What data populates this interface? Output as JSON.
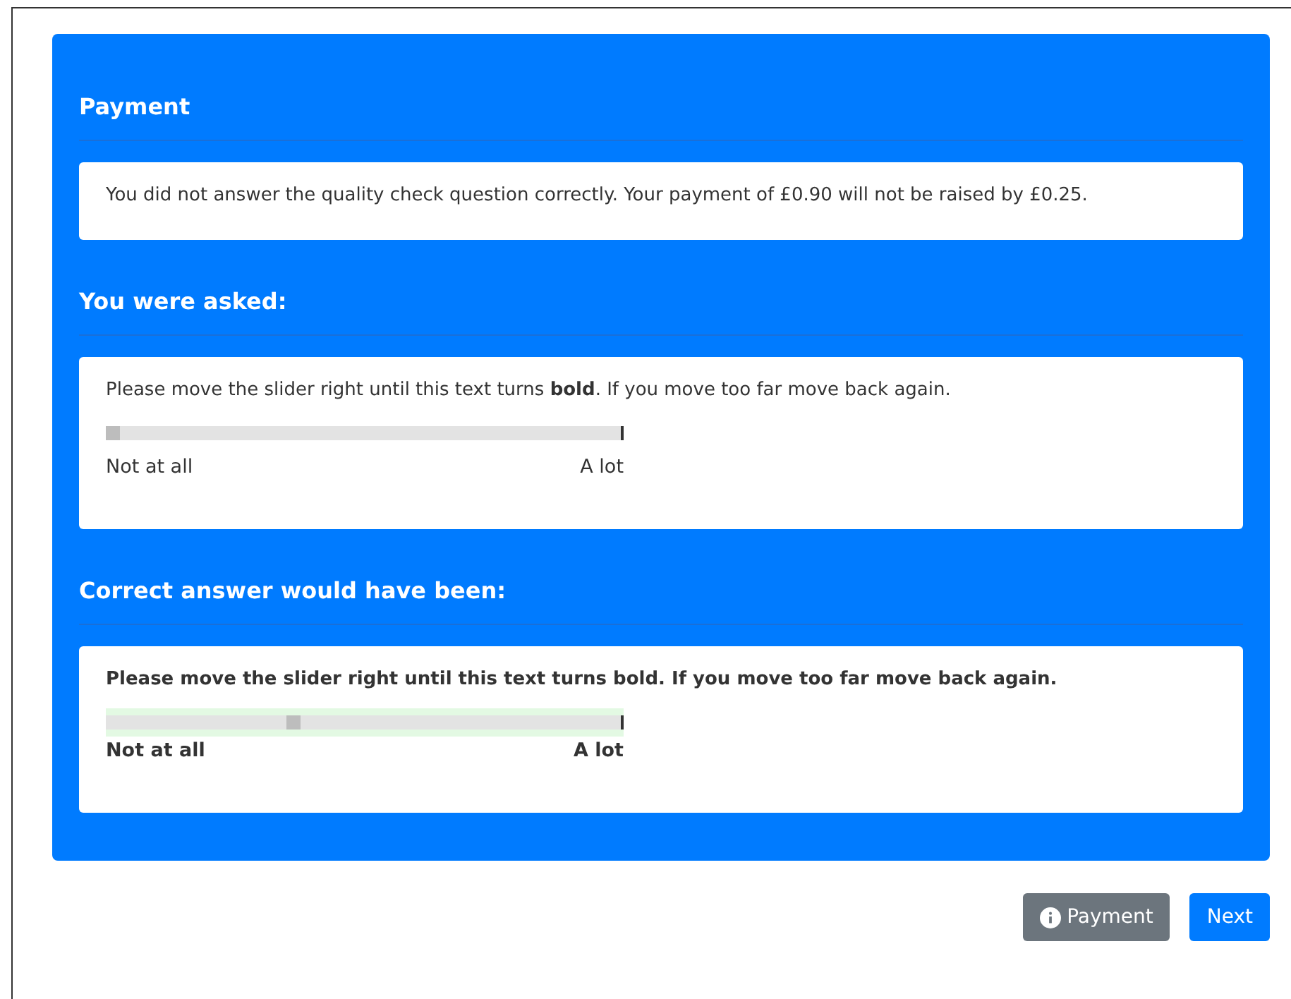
{
  "sections": [
    {
      "heading": "Payment",
      "kind": "message",
      "text": "You did not answer the quality check question correctly. Your payment of £0.90 will not be raised by £0.25."
    },
    {
      "heading": "You were asked:",
      "kind": "question",
      "correct": false,
      "text": "Please move the slider right until this text turns **bold**. If you move too far move back again.",
      "slider": {
        "level": 0.0,
        "min_label": "Not at all",
        "max_label": "A lot"
      }
    },
    {
      "heading": "Correct answer would have been:",
      "kind": "question",
      "correct": true,
      "text": "Please move the slider right until this text turns bold. If you move too far move back again.",
      "slider": {
        "level": 0.35,
        "min_label": "Not at all",
        "max_label": "A lot"
      }
    }
  ],
  "buttons": [
    {
      "label": "Payment",
      "kind": "secondary",
      "icon": true
    },
    {
      "label": "Next",
      "kind": "primary",
      "icon": false
    }
  ]
}
